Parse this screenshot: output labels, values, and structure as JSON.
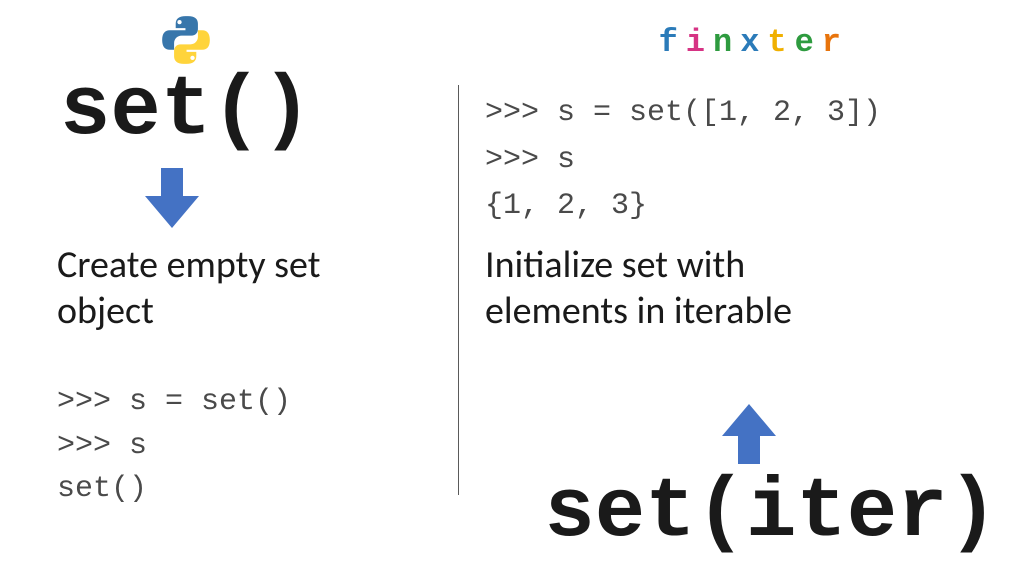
{
  "logo": {
    "brand": "finxter",
    "letters": [
      "f",
      "i",
      "n",
      "x",
      "t",
      "e",
      "r"
    ]
  },
  "left": {
    "title": "set()",
    "description_line1": "Create empty set",
    "description_line2": "object",
    "code_line1": ">>> s = set()",
    "code_line2": ">>> s",
    "code_line3": "set()"
  },
  "right": {
    "title": "set(iter)",
    "description_line1": "Initialize set with",
    "description_line2": "elements in iterable",
    "code_line1": ">>> s = set([1, 2, 3])",
    "code_line2": ">>> s",
    "code_line3": "{1, 2, 3}"
  },
  "colors": {
    "arrow": "#4472c4",
    "python_blue": "#3776ab",
    "python_yellow": "#ffd43b"
  }
}
